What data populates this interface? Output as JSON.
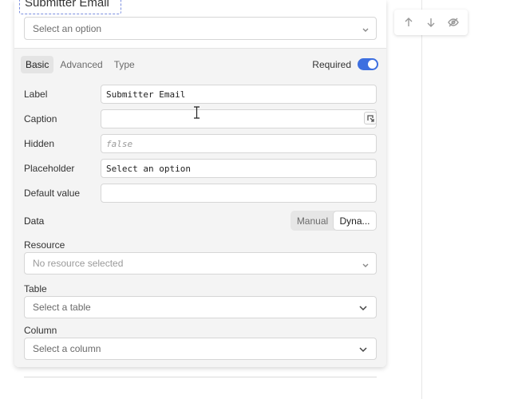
{
  "component": {
    "label_text": "Submitter Email",
    "preview_select_text": "Select an option"
  },
  "toolbar": {
    "up_icon": "arrow-up-icon",
    "down_icon": "arrow-down-icon",
    "hide_icon": "eye-off-icon"
  },
  "tabs": [
    {
      "label": "Basic",
      "active": true
    },
    {
      "label": "Advanced",
      "active": false
    },
    {
      "label": "Type",
      "active": false
    }
  ],
  "required": {
    "label": "Required",
    "on": true
  },
  "fields": {
    "label": {
      "label": "Label",
      "value": "Submitter Email"
    },
    "caption": {
      "label": "Caption",
      "value": ""
    },
    "hidden": {
      "label": "Hidden",
      "value": "false"
    },
    "placeholder": {
      "label": "Placeholder",
      "value": "Select an option"
    },
    "default_value": {
      "label": "Default value",
      "value": ""
    }
  },
  "data": {
    "label": "Data",
    "options": [
      "Manual",
      "Dyna..."
    ],
    "selected": "Dyna..."
  },
  "resource": {
    "label": "Resource",
    "value": "No resource selected"
  },
  "table": {
    "label": "Table",
    "value": "Select a table"
  },
  "column": {
    "label": "Column",
    "value": "Select a column"
  },
  "colors": {
    "accent": "#3d6fe0"
  }
}
